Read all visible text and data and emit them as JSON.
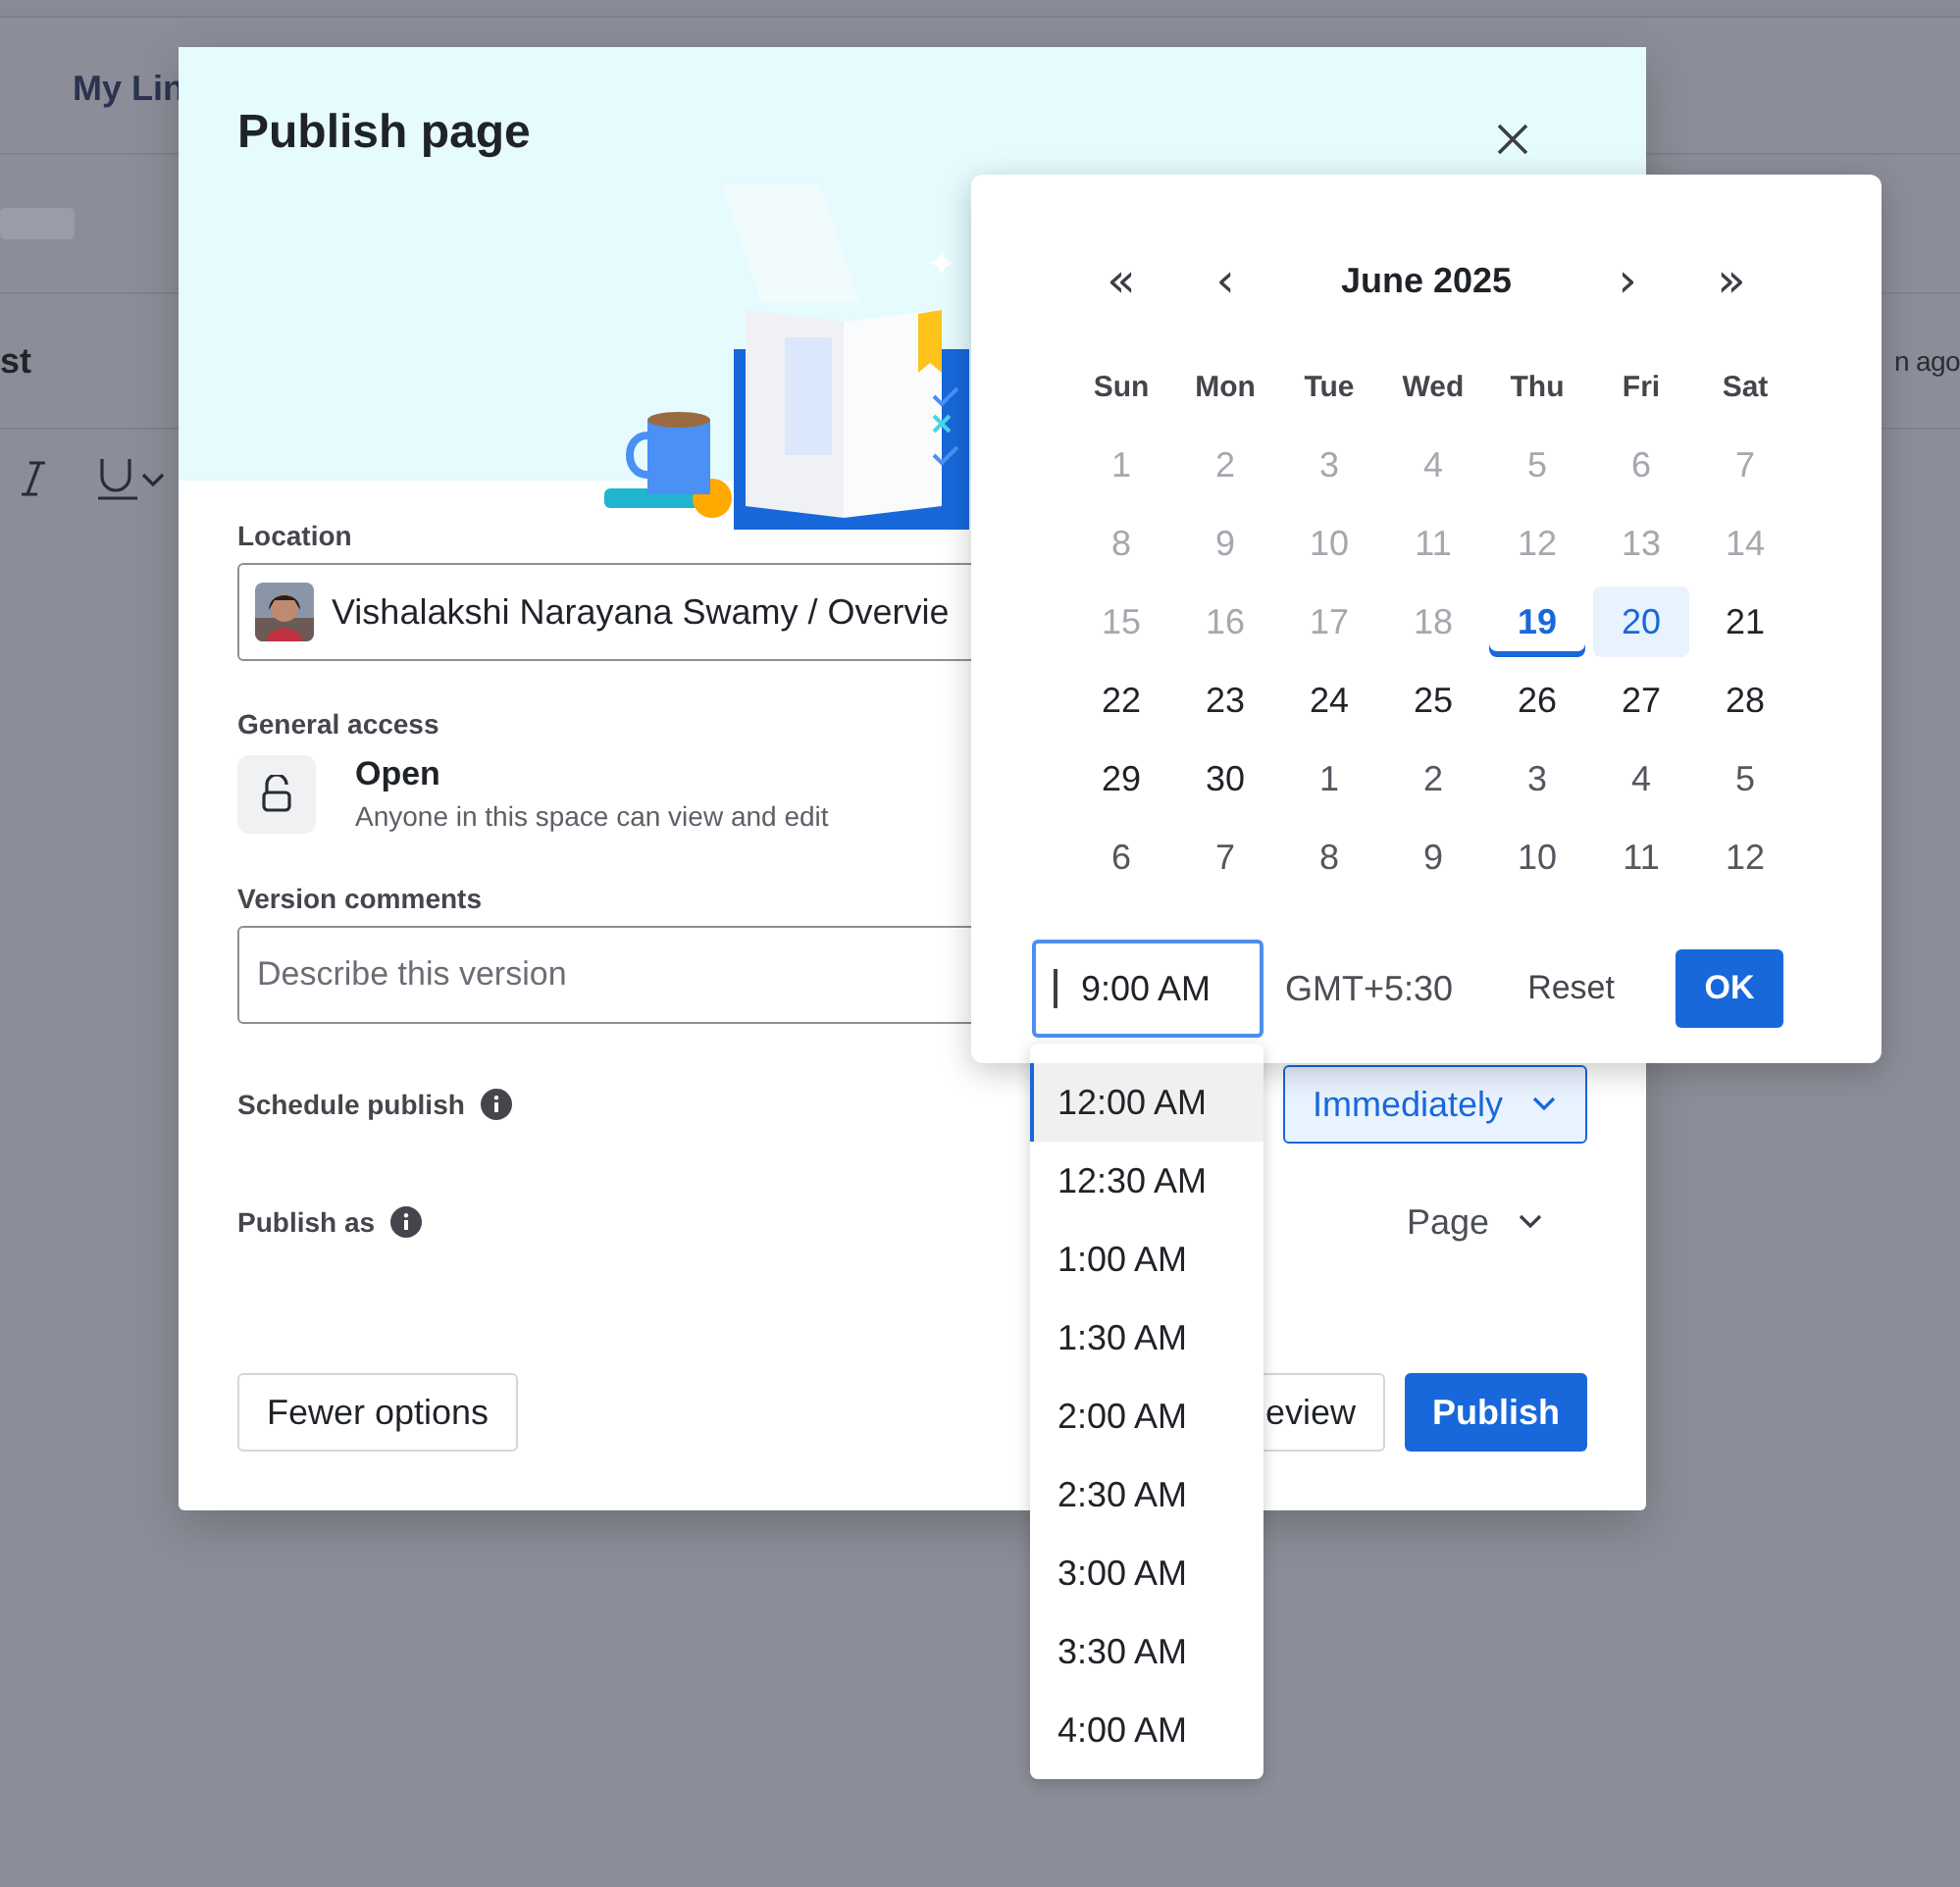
{
  "background": {
    "heading": "My Lin",
    "row_left": "st",
    "row_right": "n ago"
  },
  "dialog": {
    "title": "Publish page",
    "location": {
      "label": "Location",
      "value": "Vishalakshi Narayana Swamy / Overvie"
    },
    "access": {
      "label": "General access",
      "title": "Open",
      "description": "Anyone in this space can view and edit"
    },
    "version": {
      "label": "Version comments",
      "placeholder": "Describe this version"
    },
    "schedule": {
      "label": "Schedule publish",
      "value": "Immediately"
    },
    "publish_as": {
      "label": "Publish as",
      "value": "Page"
    },
    "buttons": [
      {
        "label": "Fewer options",
        "kind": "secondary"
      },
      {
        "label": "eview",
        "kind": "secondary"
      },
      {
        "label": "Publish",
        "kind": "primary"
      }
    ]
  },
  "calendar": {
    "month": "June 2025",
    "nav": [
      "«",
      "‹",
      "›",
      "»"
    ],
    "weekdays": [
      "Sun",
      "Mon",
      "Tue",
      "Wed",
      "Thu",
      "Fri",
      "Sat"
    ],
    "days": [
      {
        "label": "1",
        "kind": "past",
        "selected": false
      },
      {
        "label": "2",
        "kind": "past",
        "selected": false
      },
      {
        "label": "3",
        "kind": "past",
        "selected": false
      },
      {
        "label": "4",
        "kind": "past",
        "selected": false
      },
      {
        "label": "5",
        "kind": "past",
        "selected": false
      },
      {
        "label": "6",
        "kind": "past",
        "selected": false
      },
      {
        "label": "7",
        "kind": "past",
        "selected": false
      },
      {
        "label": "8",
        "kind": "past",
        "selected": false
      },
      {
        "label": "9",
        "kind": "past",
        "selected": false
      },
      {
        "label": "10",
        "kind": "past",
        "selected": false
      },
      {
        "label": "11",
        "kind": "past",
        "selected": false
      },
      {
        "label": "12",
        "kind": "past",
        "selected": false
      },
      {
        "label": "13",
        "kind": "past",
        "selected": false
      },
      {
        "label": "14",
        "kind": "past",
        "selected": false
      },
      {
        "label": "15",
        "kind": "past",
        "selected": false
      },
      {
        "label": "16",
        "kind": "past",
        "selected": false
      },
      {
        "label": "17",
        "kind": "past",
        "selected": false
      },
      {
        "label": "18",
        "kind": "past",
        "selected": false
      },
      {
        "label": "19",
        "kind": "today",
        "selected": false
      },
      {
        "label": "20",
        "kind": "current",
        "selected": true
      },
      {
        "label": "21",
        "kind": "current",
        "selected": false
      },
      {
        "label": "22",
        "kind": "current",
        "selected": false
      },
      {
        "label": "23",
        "kind": "current",
        "selected": false
      },
      {
        "label": "24",
        "kind": "current",
        "selected": false
      },
      {
        "label": "25",
        "kind": "current",
        "selected": false
      },
      {
        "label": "26",
        "kind": "current",
        "selected": false
      },
      {
        "label": "27",
        "kind": "current",
        "selected": false
      },
      {
        "label": "28",
        "kind": "current",
        "selected": false
      },
      {
        "label": "29",
        "kind": "current",
        "selected": false
      },
      {
        "label": "30",
        "kind": "current",
        "selected": false
      },
      {
        "label": "1",
        "kind": "other",
        "selected": false
      },
      {
        "label": "2",
        "kind": "other",
        "selected": false
      },
      {
        "label": "3",
        "kind": "other",
        "selected": false
      },
      {
        "label": "4",
        "kind": "other",
        "selected": false
      },
      {
        "label": "5",
        "kind": "other",
        "selected": false
      },
      {
        "label": "6",
        "kind": "other",
        "selected": false
      },
      {
        "label": "7",
        "kind": "other",
        "selected": false
      },
      {
        "label": "8",
        "kind": "other",
        "selected": false
      },
      {
        "label": "9",
        "kind": "other",
        "selected": false
      },
      {
        "label": "10",
        "kind": "other",
        "selected": false
      },
      {
        "label": "11",
        "kind": "other",
        "selected": false
      },
      {
        "label": "12",
        "kind": "other",
        "selected": false
      }
    ],
    "time": "9:00 AM",
    "timezone": "GMT+5:30",
    "reset": "Reset",
    "ok": "OK"
  },
  "time_options": [
    {
      "label": "12:00 AM",
      "selected": true
    },
    {
      "label": "12:30 AM",
      "selected": false
    },
    {
      "label": "1:00 AM",
      "selected": false
    },
    {
      "label": "1:30 AM",
      "selected": false
    },
    {
      "label": "2:00 AM",
      "selected": false
    },
    {
      "label": "2:30 AM",
      "selected": false
    },
    {
      "label": "3:00 AM",
      "selected": false
    },
    {
      "label": "3:30 AM",
      "selected": false
    },
    {
      "label": "4:00 AM",
      "selected": false
    }
  ]
}
